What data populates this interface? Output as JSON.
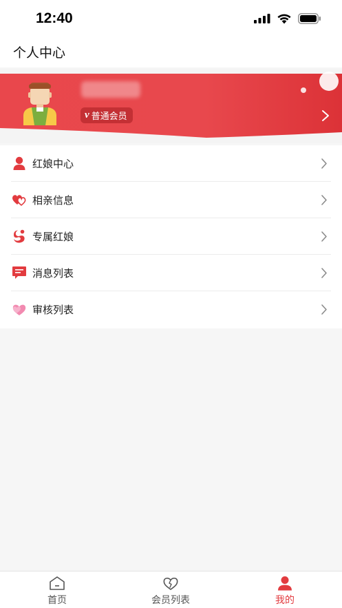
{
  "status_bar": {
    "time": "12:40"
  },
  "nav": {
    "title": "个人中心"
  },
  "profile": {
    "member_level": "普通会员",
    "badge_letter": "v"
  },
  "menu": {
    "items": [
      {
        "label": "红娘中心",
        "icon": "person-icon"
      },
      {
        "label": "相亲信息",
        "icon": "hearts-icon"
      },
      {
        "label": "专属红娘",
        "icon": "swirl-icon"
      },
      {
        "label": "消息列表",
        "icon": "message-icon"
      },
      {
        "label": "审核列表",
        "icon": "heart-review-icon"
      }
    ]
  },
  "tabs": [
    {
      "label": "首页",
      "icon": "home-icon"
    },
    {
      "label": "会员列表",
      "icon": "heart-outline-icon"
    },
    {
      "label": "我的",
      "icon": "profile-icon",
      "active": true
    }
  ],
  "colors": {
    "accent": "#e23b3f",
    "banner": "#e84a4f"
  }
}
